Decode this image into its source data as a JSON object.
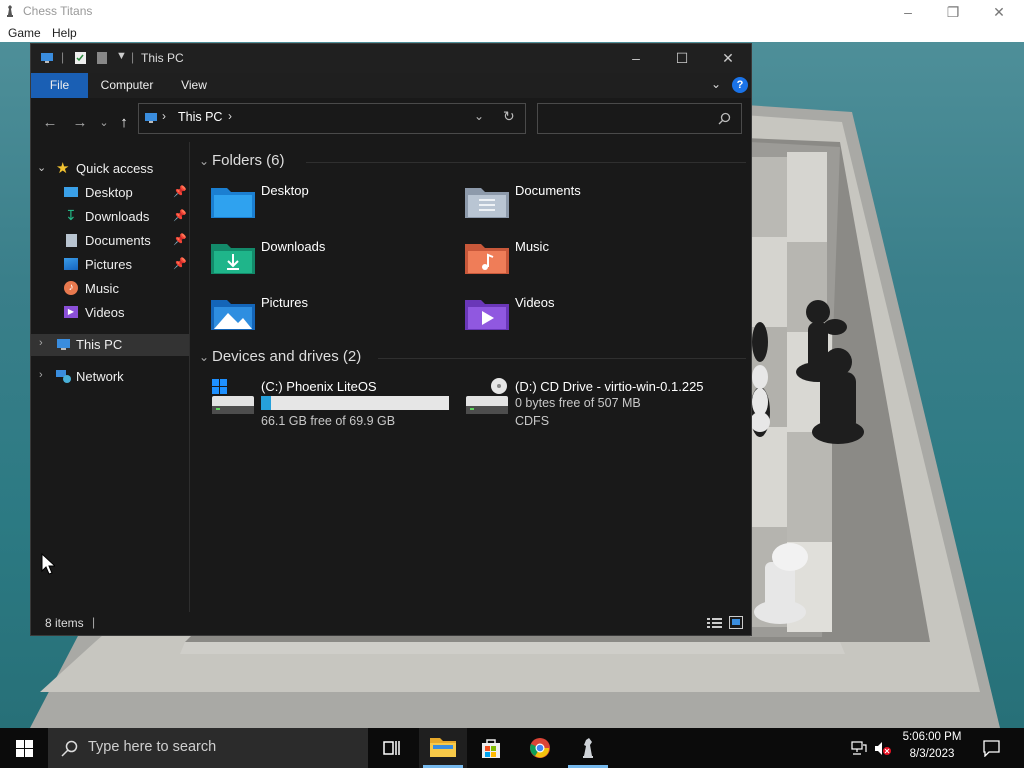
{
  "chess": {
    "title": "Chess Titans",
    "menu": [
      "Game",
      "Help"
    ]
  },
  "explorer": {
    "title": "This PC",
    "ribbon_tabs": [
      "File",
      "Computer",
      "View"
    ],
    "address_path": [
      "This PC"
    ],
    "search_placeholder": "",
    "nav": {
      "quick_access": "Quick access",
      "quick_items": [
        {
          "label": "Desktop",
          "pinned": true
        },
        {
          "label": "Downloads",
          "pinned": true
        },
        {
          "label": "Documents",
          "pinned": true
        },
        {
          "label": "Pictures",
          "pinned": true
        },
        {
          "label": "Music",
          "pinned": false
        },
        {
          "label": "Videos",
          "pinned": false
        }
      ],
      "this_pc": "This PC",
      "network": "Network"
    },
    "folders_header": "Folders (6)",
    "folders": [
      {
        "label": "Desktop",
        "icon": "desktop-folder-icon"
      },
      {
        "label": "Documents",
        "icon": "documents-folder-icon"
      },
      {
        "label": "Downloads",
        "icon": "downloads-folder-icon"
      },
      {
        "label": "Music",
        "icon": "music-folder-icon"
      },
      {
        "label": "Pictures",
        "icon": "pictures-folder-icon"
      },
      {
        "label": "Videos",
        "icon": "videos-folder-icon"
      }
    ],
    "drives_header": "Devices and drives (2)",
    "drives": [
      {
        "label": "(C:) Phoenix LiteOS",
        "free_text": "66.1 GB free of 69.9 GB",
        "used_fraction": 0.054
      },
      {
        "label": "(D:) CD Drive - virtio-win-0.1.225",
        "free_text": "0 bytes free of 507 MB",
        "fs": "CDFS"
      }
    ],
    "status_items": "8 items"
  },
  "taskbar": {
    "search_placeholder": "Type here to search",
    "time": "5:06:00 PM",
    "date": "8/3/2023"
  },
  "colors": {
    "explorer_bg": "#191919",
    "accent": "#1a5fb4",
    "taskbar_bg": "#0b0b0b"
  }
}
